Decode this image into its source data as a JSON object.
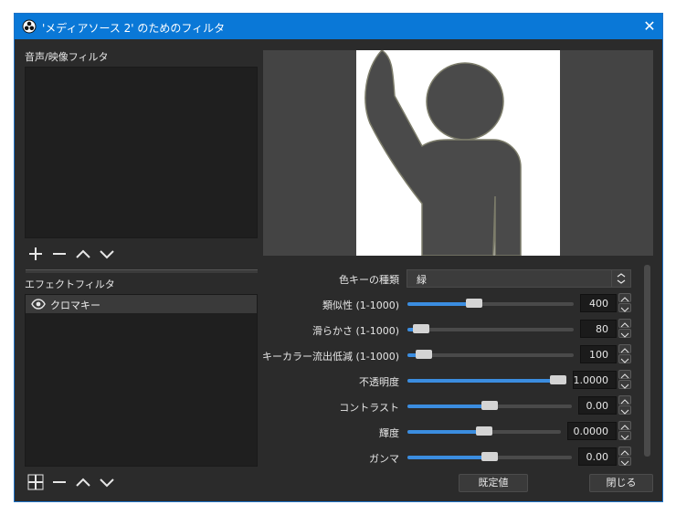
{
  "window": {
    "title": "'メディアソース 2' のためのフィルタ",
    "close_symbol": "✕"
  },
  "audio_video_filters": {
    "label": "音声/映像フィルタ",
    "items": []
  },
  "effect_filters": {
    "label": "エフェクトフィルタ",
    "items": [
      {
        "name": "クロマキー",
        "visible": true
      }
    ]
  },
  "properties": {
    "key_color_type": {
      "label": "色キーの種類",
      "value": "緑"
    },
    "similarity": {
      "label": "類似性 (1-1000)",
      "value": "400",
      "fraction": 0.4
    },
    "smoothness": {
      "label": "滑らかさ (1-1000)",
      "value": "80",
      "fraction": 0.08
    },
    "spill_reduction": {
      "label": "キーカラー流出低減 (1-1000)",
      "value": "100",
      "fraction": 0.1
    },
    "opacity": {
      "label": "不透明度",
      "value": "1.0000",
      "fraction": 1.0
    },
    "contrast": {
      "label": "コントラスト",
      "value": "0.00",
      "fraction": 0.5
    },
    "brightness": {
      "label": "輝度",
      "value": "0.0000",
      "fraction": 0.5
    },
    "gamma": {
      "label": "ガンマ",
      "value": "0.00",
      "fraction": 0.5
    }
  },
  "buttons": {
    "defaults": "既定値",
    "close": "閉じる"
  },
  "colors": {
    "accent": "#3b8de0",
    "titlebar": "#0a78d7",
    "background": "#2b2b2b"
  }
}
